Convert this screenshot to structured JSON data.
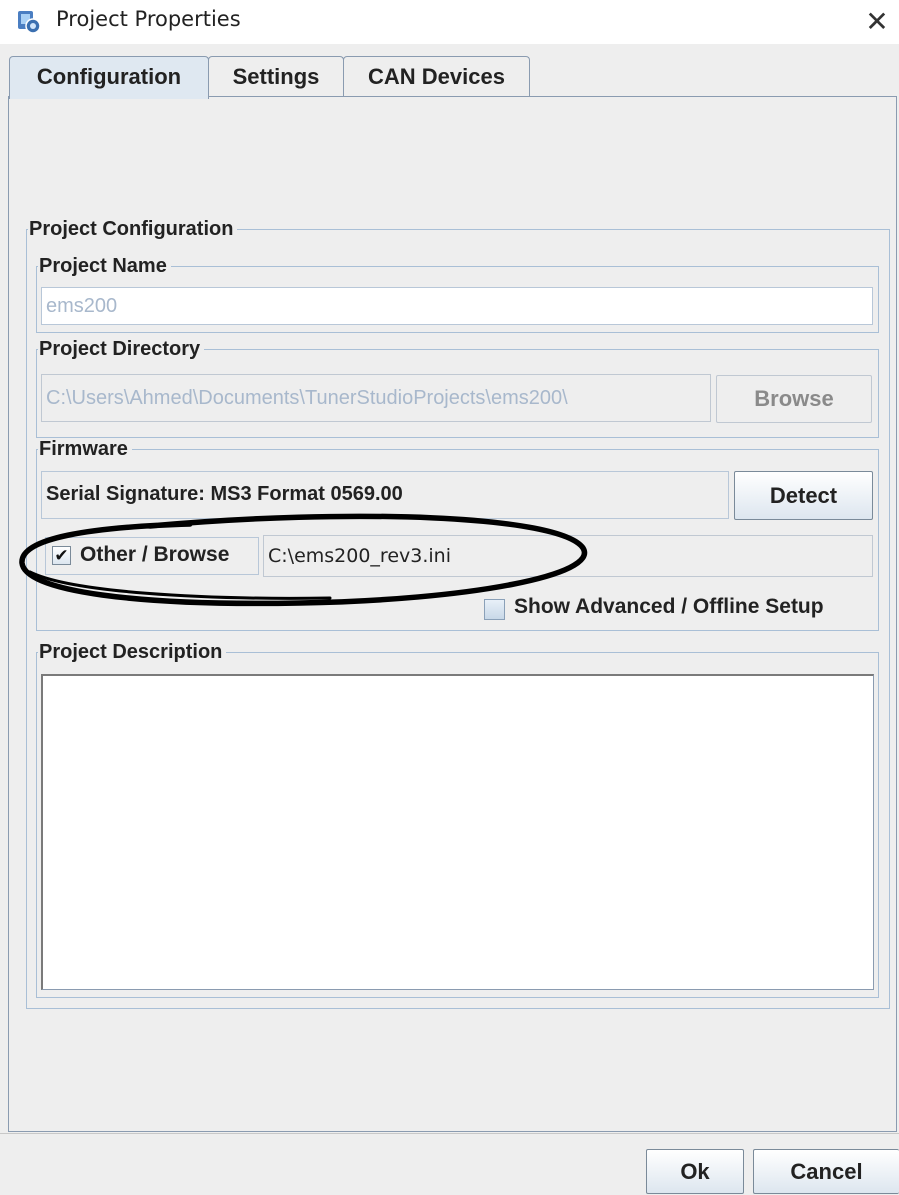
{
  "window": {
    "title": "Project Properties",
    "close_glyph": "✕",
    "app_icon": "tunerstudio-app-icon"
  },
  "tabs": [
    {
      "label": "Configuration",
      "active": true
    },
    {
      "label": "Settings",
      "active": false
    },
    {
      "label": "CAN Devices",
      "active": false
    }
  ],
  "project_configuration": {
    "legend": "Project Configuration",
    "project_name": {
      "legend": "Project Name",
      "value": "ems200"
    },
    "project_directory": {
      "legend": "Project Directory",
      "value": "C:\\Users\\Ahmed\\Documents\\TunerStudioProjects\\ems200\\",
      "browse_label": "Browse"
    },
    "firmware": {
      "legend": "Firmware",
      "serial_signature": "Serial Signature: MS3 Format 0569.00",
      "detect_label": "Detect",
      "other_browse": {
        "label": "Other / Browse",
        "checked": true,
        "check_glyph": "✔"
      },
      "ini_path": "C:\\ems200_rev3.ini",
      "show_advanced": {
        "label": "Show Advanced / Offline Setup",
        "checked": false
      }
    },
    "project_description": {
      "legend": "Project Description",
      "value": ""
    }
  },
  "footer": {
    "ok_label": "Ok",
    "cancel_label": "Cancel"
  },
  "colors": {
    "active_tab": "#dfe8f1",
    "group_border": "#a9bfd6",
    "annotation_ink": "#000000"
  }
}
